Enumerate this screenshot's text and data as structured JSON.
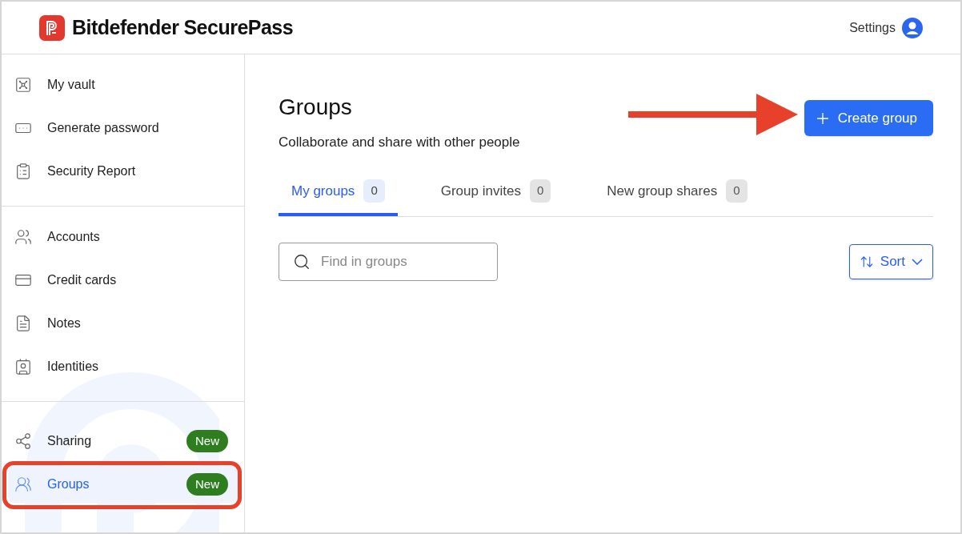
{
  "header": {
    "brand": "Bitdefender",
    "brand_suffix": "SecurePass",
    "settings": "Settings"
  },
  "sidebar": {
    "sections": [
      {
        "items": [
          {
            "kind": "vault",
            "label": "My vault",
            "selected": false,
            "highlighted": false
          },
          {
            "kind": "password",
            "label": "Generate password",
            "selected": false,
            "highlighted": false
          },
          {
            "kind": "report",
            "label": "Security Report",
            "selected": false,
            "highlighted": false
          }
        ]
      },
      {
        "items": [
          {
            "kind": "accounts",
            "label": "Accounts",
            "selected": false,
            "highlighted": false
          },
          {
            "kind": "cards",
            "label": "Credit cards",
            "selected": false,
            "highlighted": false
          },
          {
            "kind": "notes",
            "label": "Notes",
            "selected": false,
            "highlighted": false
          },
          {
            "kind": "identities",
            "label": "Identities",
            "selected": false,
            "highlighted": false
          }
        ]
      },
      {
        "items": [
          {
            "kind": "sharing",
            "label": "Sharing",
            "selected": false,
            "badge": "New",
            "highlighted": false
          },
          {
            "kind": "groups",
            "label": "Groups",
            "selected": true,
            "badge": "New",
            "highlighted": true
          }
        ]
      }
    ]
  },
  "main": {
    "title": "Groups",
    "subtitle": "Collaborate and share with other people",
    "create_button": "Create group",
    "arrow_annotation": true,
    "tabs": [
      {
        "label": "My groups",
        "count": "0",
        "selected": true
      },
      {
        "label": "Group invites",
        "count": "0",
        "selected": false
      },
      {
        "label": "New group shares",
        "count": "0",
        "selected": false
      }
    ],
    "search": {
      "placeholder": "Find in groups"
    },
    "sort_button": "Sort"
  }
}
